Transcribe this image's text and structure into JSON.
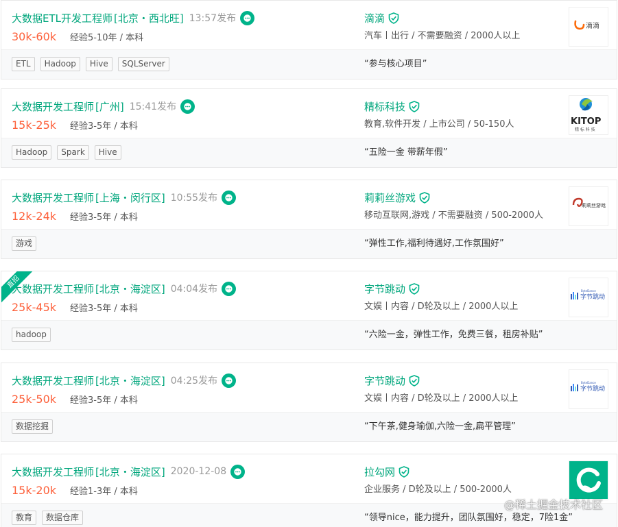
{
  "jobs": [
    {
      "title": "大数据ETL开发工程师",
      "location": "[北京・西北旺]",
      "publish_time": "13:57发布",
      "salary": "30k-60k",
      "requirement": "经验5-10年 / 本科",
      "company": "滴滴",
      "industry": "汽车丨出行 / 不需要融资 / 2000人以上",
      "tags": [
        "ETL",
        "Hadoop",
        "Hive",
        "SQLServer"
      ],
      "benefits": "“参与核心项目”",
      "logo": {
        "icon": "didi-logo",
        "text": "滴滴"
      },
      "ribbon": ""
    },
    {
      "title": "大数据开发工程师",
      "location": "[广州]",
      "publish_time": "15:41发布",
      "salary": "15k-25k",
      "requirement": "经验3-5年 / 本科",
      "company": "精标科技",
      "industry": "教育,软件开发 / 上市公司 / 50-150人",
      "tags": [
        "Hadoop",
        "Spark",
        "Hive"
      ],
      "benefits": "“五险一金 带薪年假”",
      "logo": {
        "icon": "kitop-logo",
        "text": "KITOP",
        "subtext": "精 标 科 技"
      },
      "ribbon": ""
    },
    {
      "title": "大数据开发工程师",
      "location": "[上海・闵行区]",
      "publish_time": "10:55发布",
      "salary": "12k-24k",
      "requirement": "经验3-5年 / 本科",
      "company": "莉莉丝游戏",
      "industry": "移动互联网,游戏 / 不需要融资 / 500-2000人",
      "tags": [
        "游戏"
      ],
      "benefits": "“弹性工作,福利待遇好,工作氛围好”",
      "logo": {
        "icon": "lilith-logo",
        "text": "莉莉丝游戏"
      },
      "ribbon": ""
    },
    {
      "title": "大数据开发工程师",
      "location": "[北京・海淀区]",
      "publish_time": "04:04发布",
      "salary": "25k-45k",
      "requirement": "经验3-5年 / 本科",
      "company": "字节跳动",
      "industry": "文娱丨内容 / D轮及以上 / 2000人以上",
      "tags": [
        "hadoop"
      ],
      "benefits": "“六险一金，弹性工作，免费三餐，租房补贴”",
      "logo": {
        "icon": "bytedance-logo",
        "text": "字节跳动",
        "subtext": "ByteDance"
      },
      "ribbon": "直招"
    },
    {
      "title": "大数据开发工程师",
      "location": "[北京・海淀区]",
      "publish_time": "04:25发布",
      "salary": "25k-50k",
      "requirement": "经验3-5年 / 本科",
      "company": "字节跳动",
      "industry": "文娱丨内容 / D轮及以上 / 2000人以上",
      "tags": [
        "数据挖掘"
      ],
      "benefits": "“下午茶,健身瑜伽,六险一金,扁平管理”",
      "logo": {
        "icon": "bytedance-logo",
        "text": "字节跳动",
        "subtext": "ByteDance"
      },
      "ribbon": ""
    },
    {
      "title": "大数据开发工程师",
      "location": "[北京・海淀区]",
      "publish_time": "2020-12-08",
      "salary": "15k-20k",
      "requirement": "经验1-3年 / 本科",
      "company": "拉勾网",
      "industry": "企业服务 / D轮及以上 / 500-2000人",
      "tags": [
        "教育",
        "数据仓库"
      ],
      "benefits": "“领导nice，能力提升，团队氛围好，稳定，7险1金”",
      "logo": {
        "icon": "lagou-logo",
        "text": ""
      },
      "ribbon": ""
    }
  ],
  "watermark": "@稀土掘金技术社区",
  "colors": {
    "accent": "#00a67c",
    "salary": "#fd5f39",
    "icon_green": "#00b38a"
  }
}
